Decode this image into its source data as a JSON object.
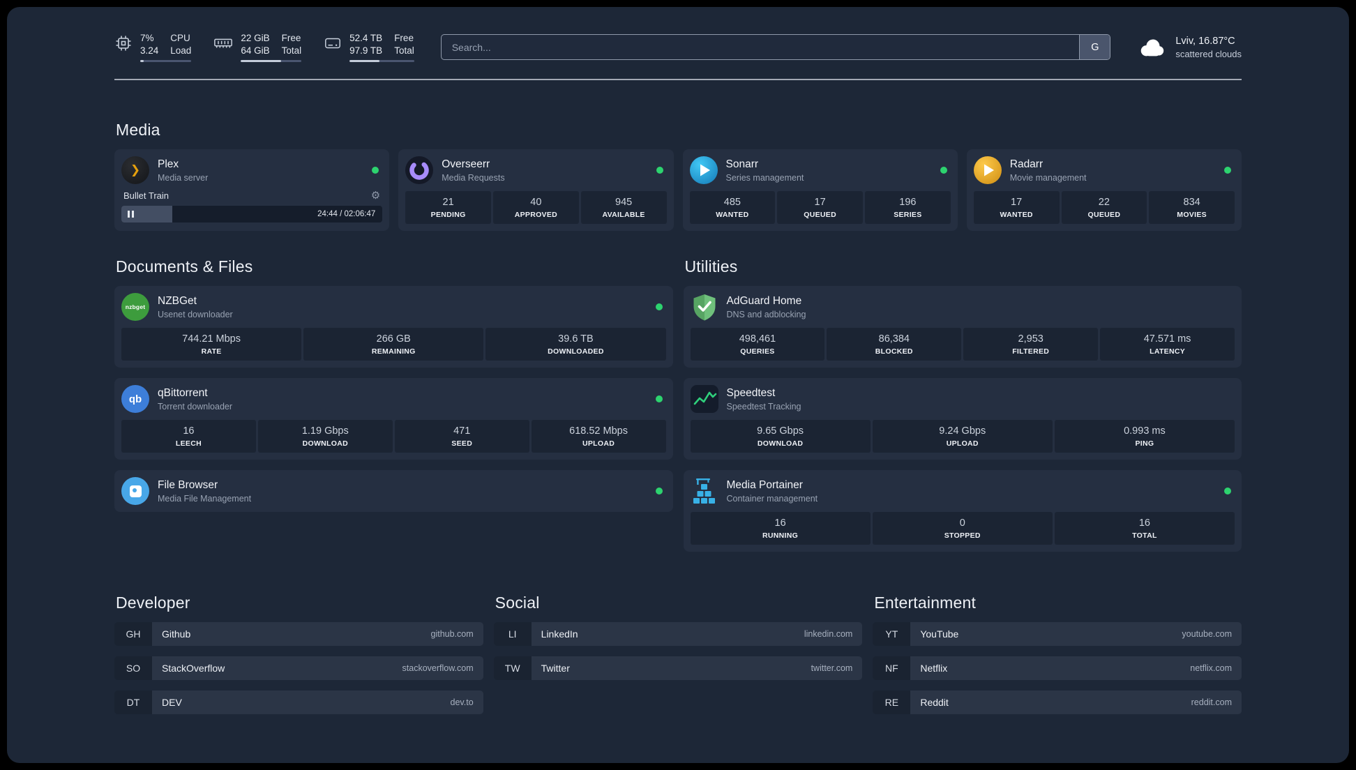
{
  "topbar": {
    "resources": {
      "cpu": {
        "icon": "cpu-icon",
        "value_top": "7%",
        "value_bottom": "3.24",
        "label_top": "CPU",
        "label_bottom": "Load",
        "bar_percent": 7
      },
      "memory": {
        "icon": "memory-icon",
        "value_top": "22 GiB",
        "value_bottom": "64 GiB",
        "label_top": "Free",
        "label_bottom": "Total",
        "bar_percent": 66
      },
      "disk": {
        "icon": "disk-icon",
        "value_top": "52.4 TB",
        "value_bottom": "97.9 TB",
        "label_top": "Free",
        "label_bottom": "Total",
        "bar_percent": 46
      }
    },
    "search": {
      "placeholder": "Search...",
      "provider_button": "G"
    },
    "weather": {
      "icon": "cloud-icon",
      "location": "Lviv, 16.87°C",
      "condition": "scattered clouds"
    }
  },
  "media": {
    "title": "Media",
    "plex": {
      "name": "Plex",
      "desc": "Media server",
      "icon": "plex-icon",
      "status": "online",
      "now_playing": "Bullet Train",
      "time": "24:44 / 02:06:47",
      "progress_percent": 19.5
    },
    "overseerr": {
      "name": "Overseerr",
      "desc": "Media Requests",
      "icon": "overseerr-icon",
      "status": "online",
      "stats": [
        {
          "value": "21",
          "label": "PENDING"
        },
        {
          "value": "40",
          "label": "APPROVED"
        },
        {
          "value": "945",
          "label": "AVAILABLE"
        }
      ]
    },
    "sonarr": {
      "name": "Sonarr",
      "desc": "Series management",
      "icon": "sonarr-icon",
      "status": "online",
      "stats": [
        {
          "value": "485",
          "label": "WANTED"
        },
        {
          "value": "17",
          "label": "QUEUED"
        },
        {
          "value": "196",
          "label": "SERIES"
        }
      ]
    },
    "radarr": {
      "name": "Radarr",
      "desc": "Movie management",
      "icon": "radarr-icon",
      "status": "online",
      "stats": [
        {
          "value": "17",
          "label": "WANTED"
        },
        {
          "value": "22",
          "label": "QUEUED"
        },
        {
          "value": "834",
          "label": "MOVIES"
        }
      ]
    }
  },
  "documents": {
    "title": "Documents & Files",
    "nzbget": {
      "name": "NZBGet",
      "desc": "Usenet downloader",
      "icon": "nzbget-icon",
      "status": "online",
      "stats": [
        {
          "value": "744.21 Mbps",
          "label": "RATE"
        },
        {
          "value": "266 GB",
          "label": "REMAINING"
        },
        {
          "value": "39.6 TB",
          "label": "DOWNLOADED"
        }
      ]
    },
    "qbittorrent": {
      "name": "qBittorrent",
      "desc": "Torrent downloader",
      "icon": "qbittorrent-icon",
      "status": "online",
      "stats": [
        {
          "value": "16",
          "label": "LEECH"
        },
        {
          "value": "1.19 Gbps",
          "label": "DOWNLOAD"
        },
        {
          "value": "471",
          "label": "SEED"
        },
        {
          "value": "618.52 Mbps",
          "label": "UPLOAD"
        }
      ]
    },
    "filebrowser": {
      "name": "File Browser",
      "desc": "Media File Management",
      "icon": "filebrowser-icon",
      "status": "online"
    }
  },
  "utilities": {
    "title": "Utilities",
    "adguard": {
      "name": "AdGuard Home",
      "desc": "DNS and adblocking",
      "icon": "adguard-icon",
      "stats": [
        {
          "value": "498,461",
          "label": "QUERIES"
        },
        {
          "value": "86,384",
          "label": "BLOCKED"
        },
        {
          "value": "2,953",
          "label": "FILTERED"
        },
        {
          "value": "47.571 ms",
          "label": "LATENCY"
        }
      ]
    },
    "speedtest": {
      "name": "Speedtest",
      "desc": "Speedtest Tracking",
      "icon": "speedtest-icon",
      "stats": [
        {
          "value": "9.65 Gbps",
          "label": "DOWNLOAD"
        },
        {
          "value": "9.24 Gbps",
          "label": "UPLOAD"
        },
        {
          "value": "0.993 ms",
          "label": "PING"
        }
      ]
    },
    "portainer": {
      "name": "Media Portainer",
      "desc": "Container management",
      "icon": "portainer-icon",
      "status": "online",
      "stats": [
        {
          "value": "16",
          "label": "RUNNING"
        },
        {
          "value": "0",
          "label": "STOPPED"
        },
        {
          "value": "16",
          "label": "TOTAL"
        }
      ]
    }
  },
  "bookmarks": {
    "developer": {
      "title": "Developer",
      "items": [
        {
          "abbr": "GH",
          "name": "Github",
          "url": "github.com"
        },
        {
          "abbr": "SO",
          "name": "StackOverflow",
          "url": "stackoverflow.com"
        },
        {
          "abbr": "DT",
          "name": "DEV",
          "url": "dev.to"
        }
      ]
    },
    "social": {
      "title": "Social",
      "items": [
        {
          "abbr": "LI",
          "name": "LinkedIn",
          "url": "linkedin.com"
        },
        {
          "abbr": "TW",
          "name": "Twitter",
          "url": "twitter.com"
        }
      ]
    },
    "entertainment": {
      "title": "Entertainment",
      "items": [
        {
          "abbr": "YT",
          "name": "YouTube",
          "url": "youtube.com"
        },
        {
          "abbr": "NF",
          "name": "Netflix",
          "url": "netflix.com"
        },
        {
          "abbr": "RE",
          "name": "Reddit",
          "url": "reddit.com"
        }
      ]
    }
  },
  "colors": {
    "page_background": "#1d2737",
    "card_background": "#252f41",
    "stat_background": "#1b2433",
    "status_online": "#2dd36f",
    "plex_accent": "#e5a00d",
    "overseerr_accent": "#a78bfa",
    "sonarr_accent": "#2aa9e0",
    "radarr_accent": "#f0a827",
    "nzbget_accent": "#3d9c3d",
    "qbittorrent_accent": "#3d7ed9",
    "adguard_accent": "#63b56f",
    "speedtest_accent": "#2fd07c",
    "filebrowser_accent": "#48a7e8",
    "portainer_accent": "#38b1e6"
  }
}
